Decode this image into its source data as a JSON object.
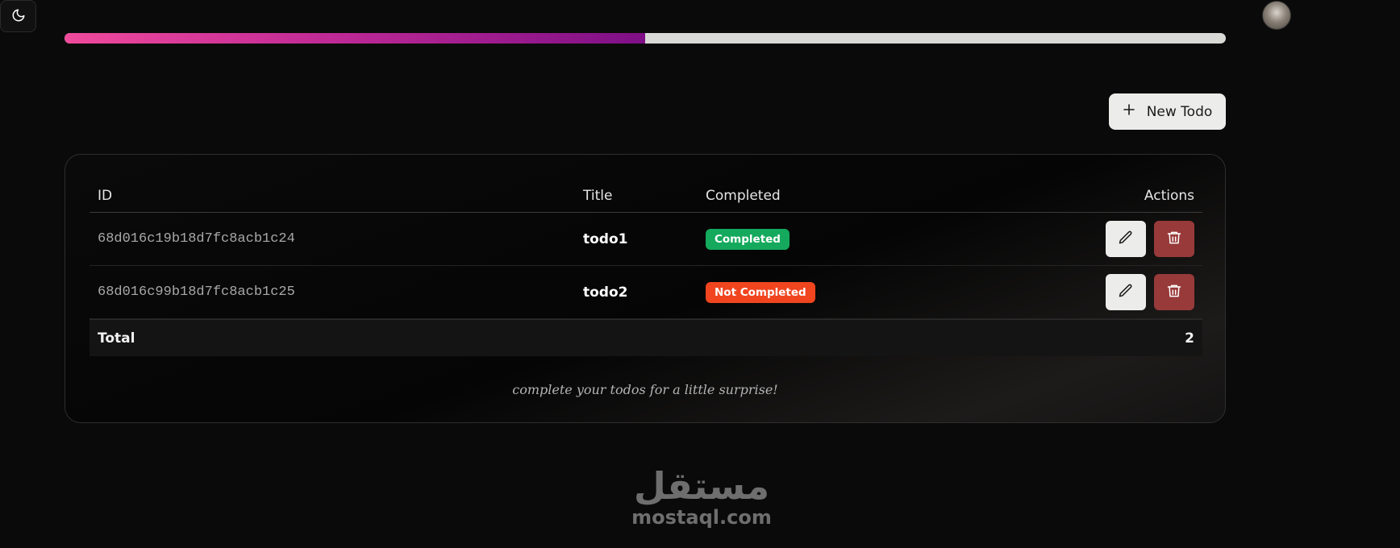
{
  "header": {
    "theme_toggle_icon": "moon-icon",
    "avatar_icon": "user-avatar",
    "progress_fraction": 0.5
  },
  "toolbar": {
    "new_todo_label": "New Todo",
    "new_todo_icon": "plus-icon"
  },
  "table": {
    "columns": {
      "id": "ID",
      "title": "Title",
      "completed": "Completed",
      "actions": "Actions"
    },
    "rows": [
      {
        "id": "68d016c19b18d7fc8acb1c24",
        "title": "todo1",
        "status": "Completed",
        "status_color": "#14a95c"
      },
      {
        "id": "68d016c99b18d7fc8acb1c25",
        "title": "todo2",
        "status": "Not Completed",
        "status_color": "#f0451f"
      }
    ],
    "edit_icon": "pencil-icon",
    "delete_icon": "trash-icon",
    "total_label": "Total",
    "total_value": "2"
  },
  "footer_note": "complete your todos for a little surprise!",
  "watermark": {
    "arabic": "مستقل",
    "latin": "mostaql.com"
  },
  "colors": {
    "progress_start": "#f04a9c",
    "progress_end": "#7e0f86",
    "delete_button": "#983a3a",
    "background": "#0b0a0a"
  }
}
